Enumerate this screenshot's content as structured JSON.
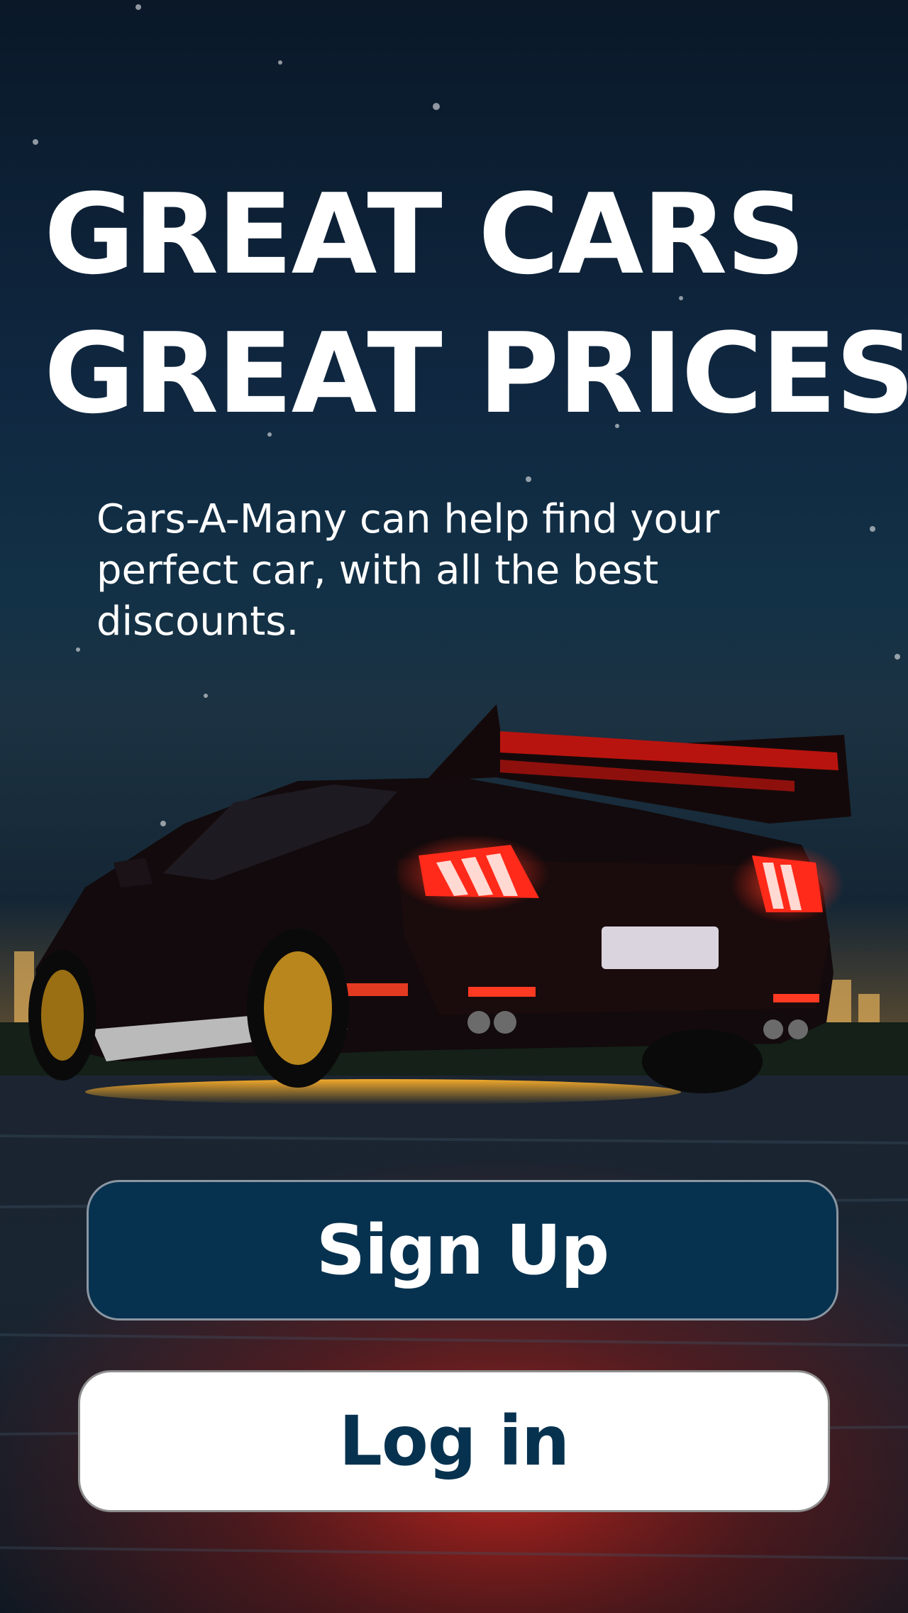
{
  "hero": {
    "headline_line1": "GREAT CARS",
    "headline_line2": "GREAT PRICES",
    "subtitle": "Cars-A-Many can help find your perfect car, with all the best discounts."
  },
  "actions": {
    "signup_label": "Sign Up",
    "login_label": "Log in"
  },
  "colors": {
    "primary": "#07324f",
    "text_light": "#ffffff",
    "night_sky": "#0b1b2a",
    "tail_light": "#ff2a1a",
    "ground_glow": "#ffb12a"
  }
}
